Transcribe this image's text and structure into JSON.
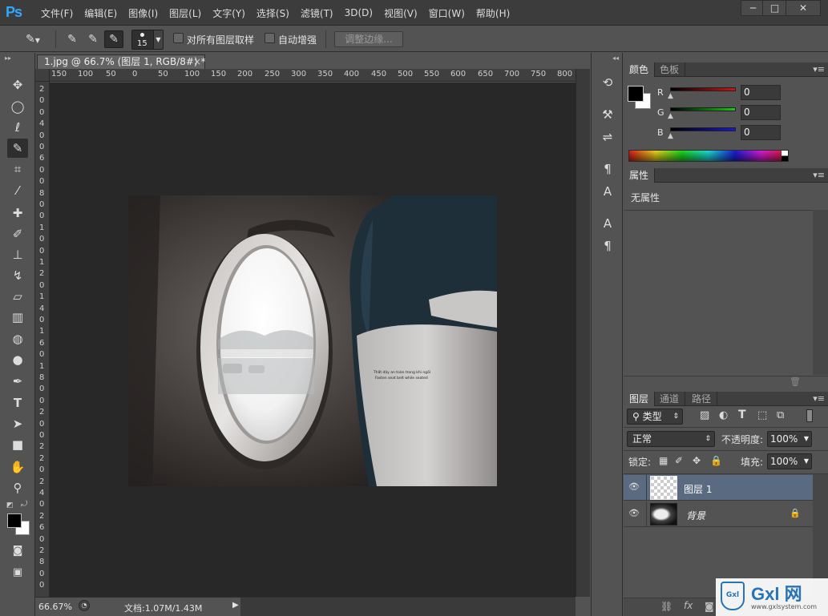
{
  "app": {
    "logo": "Ps"
  },
  "menu": [
    "文件(F)",
    "编辑(E)",
    "图像(I)",
    "图层(L)",
    "文字(Y)",
    "选择(S)",
    "滤镜(T)",
    "3D(D)",
    "视图(V)",
    "窗口(W)",
    "帮助(H)"
  ],
  "window_controls": {
    "minimize": "─",
    "maximize": "□",
    "close": "✕"
  },
  "options": {
    "brush_size": "15",
    "sample_all_layers": "对所有图层取样",
    "auto_enhance": "自动增强",
    "refine_edge": "调整边缘..."
  },
  "document": {
    "tab_title": "1.jpg @ 66.7% (图层 1, RGB/8#) *",
    "close": "×",
    "ruler_h": [
      "150",
      "100",
      "50",
      "0",
      "50",
      "100",
      "150",
      "200",
      "250",
      "300",
      "350",
      "400",
      "450",
      "500",
      "550",
      "600",
      "650",
      "700",
      "750",
      "800"
    ],
    "ruler_v": [
      "2",
      "0",
      "0",
      "4",
      "0",
      "0",
      "6",
      "0",
      "0",
      "8",
      "0",
      "0",
      "1",
      "0",
      "0",
      "1",
      "2",
      "0",
      "1",
      "4",
      "0",
      "1",
      "6",
      "0",
      "1",
      "8",
      "0",
      "0",
      "2",
      "0",
      "0",
      "2",
      "2",
      "0",
      "2",
      "4",
      "0",
      "2",
      "6",
      "0",
      "2",
      "8",
      "0",
      "0"
    ],
    "seat_text_line1": "Thắt dây an toàn trong khi ngồi",
    "seat_text_line2": "Fasten seat belt while seated"
  },
  "status": {
    "zoom": "66.67%",
    "doc_info": "文档:1.07M/1.43M"
  },
  "panels": {
    "color": {
      "tabs": [
        "颜色",
        "色板"
      ],
      "channels": [
        {
          "label": "R",
          "value": "0",
          "color": "#cc1b1b"
        },
        {
          "label": "G",
          "value": "0",
          "color": "#1bbf1b"
        },
        {
          "label": "B",
          "value": "0",
          "color": "#1b1bcc"
        }
      ]
    },
    "properties": {
      "tab": "属性",
      "empty_text": "无属性"
    },
    "layers": {
      "tabs": [
        "图层",
        "通道",
        "路径"
      ],
      "filter_kind": "类型",
      "blend_mode": "正常",
      "opacity_label": "不透明度:",
      "opacity": "100%",
      "lock_label": "锁定:",
      "fill_label": "填充:",
      "fill": "100%",
      "items": [
        {
          "name": "图层 1",
          "selected": true
        },
        {
          "name": "背景",
          "locked": true
        }
      ]
    }
  },
  "watermark": {
    "brand": "Gxl 网",
    "url": "www.gxlsystem.com"
  }
}
